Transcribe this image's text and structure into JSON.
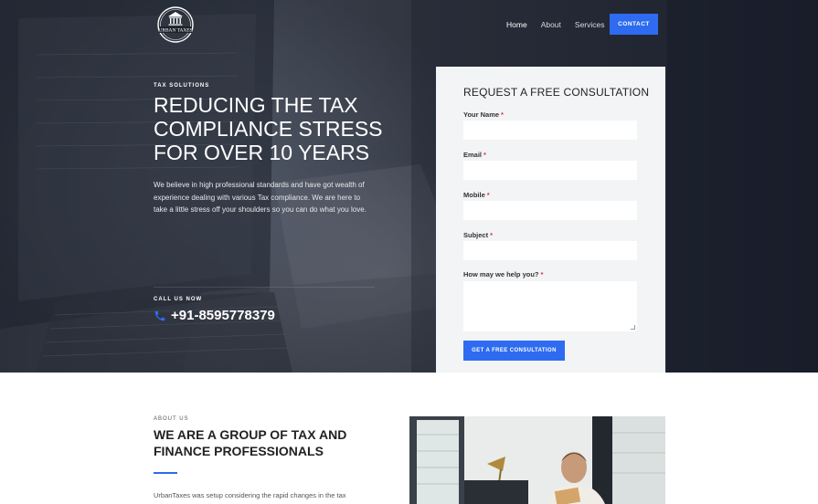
{
  "brand": {
    "logo_text": "URBAN TAXES"
  },
  "nav": {
    "items": [
      {
        "label": "Home",
        "active": true
      },
      {
        "label": "About",
        "active": false
      },
      {
        "label": "Services",
        "active": false
      }
    ],
    "cta_label": "CONTACT"
  },
  "hero": {
    "kicker": "TAX SOLUTIONS",
    "headline": [
      "REDUCING THE TAX",
      "COMPLIANCE STRESS",
      "FOR OVER 10 YEARS"
    ],
    "intro": "We believe in high professional standards and have got wealth of experience dealing with various Tax compliance. We are here to take a little stress off your shoulders so you can do what you love.",
    "call_kicker": "CALL US NOW",
    "phone": "+91-8595778379",
    "phone_icon": "phone-icon"
  },
  "form": {
    "title": "REQUEST A FREE CONSULTATION",
    "fields": [
      {
        "label": "Your Name",
        "required": "*",
        "value": ""
      },
      {
        "label": "Email",
        "required": "*",
        "value": ""
      },
      {
        "label": "Mobile",
        "required": "*",
        "value": ""
      },
      {
        "label": "Subject",
        "required": "*",
        "value": ""
      },
      {
        "label": "How may we help you?",
        "required": "*",
        "value": ""
      }
    ],
    "submit_label": "GET A FREE CONSULTATION"
  },
  "about": {
    "kicker": "ABOUT US",
    "title": [
      "WE ARE A GROUP OF TAX AND",
      "FINANCE PROFESSIONALS"
    ],
    "text": "UrbanTaxes was setup considering the rapid changes in the tax"
  },
  "colors": {
    "accent": "#2e6bf0",
    "hero_bg": "#2b303b",
    "form_bg": "#f2f4f6",
    "required": "#d23b3b"
  }
}
